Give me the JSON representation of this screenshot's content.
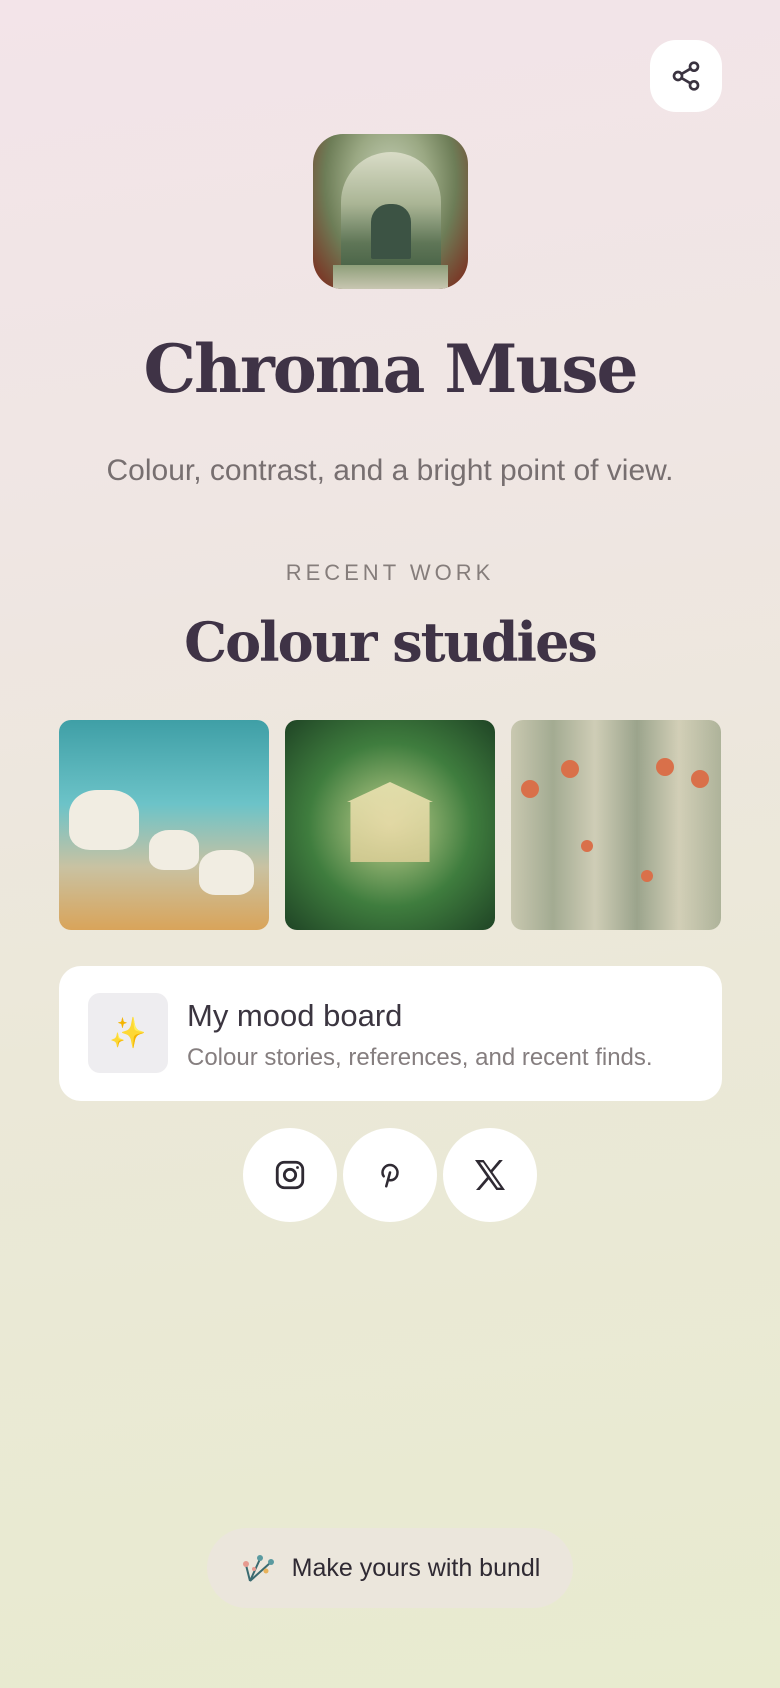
{
  "header": {
    "share_icon": "share-icon"
  },
  "profile": {
    "name": "Chroma Muse",
    "tagline": "Colour, contrast, and a bright point of view."
  },
  "recent_work": {
    "eyebrow": "RECENT WORK",
    "title": "Colour studies",
    "images": [
      {
        "name": "white goats on a rocky shore painting"
      },
      {
        "name": "classical temple in a green jungle painting"
      },
      {
        "name": "stone colonnade with red flowers painting"
      }
    ]
  },
  "link_card": {
    "icon": "sparkles-icon",
    "title": "My mood board",
    "subtitle": "Colour stories, references, and recent finds."
  },
  "socials": [
    {
      "icon": "instagram-icon"
    },
    {
      "icon": "pinterest-icon"
    },
    {
      "icon": "x-icon"
    }
  ],
  "footer": {
    "label": "Make yours with bundl",
    "icon": "bouquet-icon"
  },
  "colors": {
    "text_primary": "#3f3346",
    "text_muted": "#776f70",
    "card_bg": "#ffffff"
  }
}
